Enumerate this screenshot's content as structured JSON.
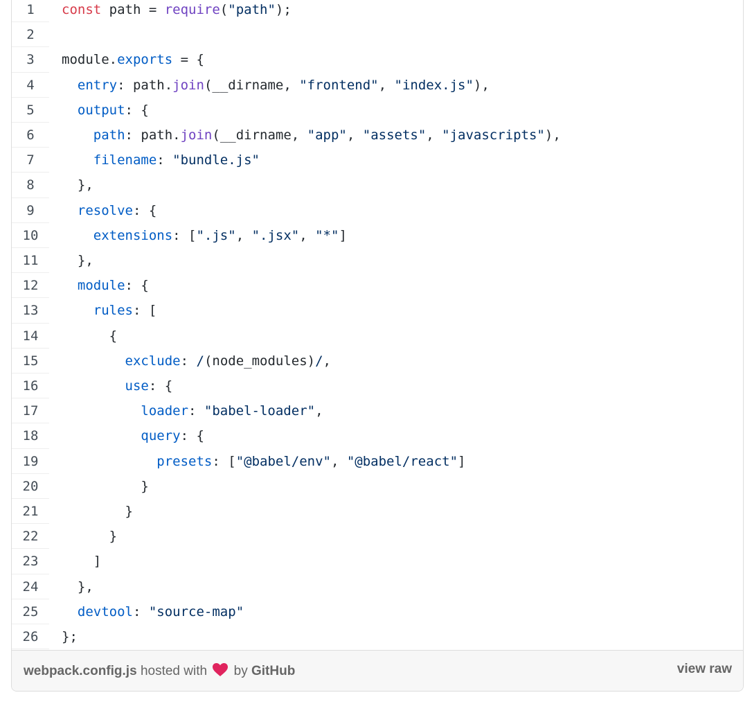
{
  "gist": {
    "lines": [
      {
        "no": "1",
        "tokens": [
          {
            "t": "kw",
            "v": "const"
          },
          {
            "t": "plain",
            "v": " path = "
          },
          {
            "t": "fn",
            "v": "require"
          },
          {
            "t": "plain",
            "v": "("
          },
          {
            "t": "str",
            "v": "\"path\""
          },
          {
            "t": "plain",
            "v": ");"
          }
        ]
      },
      {
        "no": "2",
        "tokens": []
      },
      {
        "no": "3",
        "tokens": [
          {
            "t": "plain",
            "v": "module."
          },
          {
            "t": "prop",
            "v": "exports"
          },
          {
            "t": "plain",
            "v": " = {"
          }
        ]
      },
      {
        "no": "4",
        "tokens": [
          {
            "t": "plain",
            "v": "  "
          },
          {
            "t": "prop",
            "v": "entry"
          },
          {
            "t": "plain",
            "v": ": path."
          },
          {
            "t": "fn",
            "v": "join"
          },
          {
            "t": "plain",
            "v": "(__dirname, "
          },
          {
            "t": "str",
            "v": "\"frontend\""
          },
          {
            "t": "plain",
            "v": ", "
          },
          {
            "t": "str",
            "v": "\"index.js\""
          },
          {
            "t": "plain",
            "v": "),"
          }
        ]
      },
      {
        "no": "5",
        "tokens": [
          {
            "t": "plain",
            "v": "  "
          },
          {
            "t": "prop",
            "v": "output"
          },
          {
            "t": "plain",
            "v": ": {"
          }
        ]
      },
      {
        "no": "6",
        "tokens": [
          {
            "t": "plain",
            "v": "    "
          },
          {
            "t": "prop",
            "v": "path"
          },
          {
            "t": "plain",
            "v": ": path."
          },
          {
            "t": "fn",
            "v": "join"
          },
          {
            "t": "plain",
            "v": "(__dirname, "
          },
          {
            "t": "str",
            "v": "\"app\""
          },
          {
            "t": "plain",
            "v": ", "
          },
          {
            "t": "str",
            "v": "\"assets\""
          },
          {
            "t": "plain",
            "v": ", "
          },
          {
            "t": "str",
            "v": "\"javascripts\""
          },
          {
            "t": "plain",
            "v": "),"
          }
        ]
      },
      {
        "no": "7",
        "tokens": [
          {
            "t": "plain",
            "v": "    "
          },
          {
            "t": "prop",
            "v": "filename"
          },
          {
            "t": "plain",
            "v": ": "
          },
          {
            "t": "str",
            "v": "\"bundle.js\""
          }
        ]
      },
      {
        "no": "8",
        "tokens": [
          {
            "t": "plain",
            "v": "  },"
          }
        ]
      },
      {
        "no": "9",
        "tokens": [
          {
            "t": "plain",
            "v": "  "
          },
          {
            "t": "prop",
            "v": "resolve"
          },
          {
            "t": "plain",
            "v": ": {"
          }
        ]
      },
      {
        "no": "10",
        "tokens": [
          {
            "t": "plain",
            "v": "    "
          },
          {
            "t": "prop",
            "v": "extensions"
          },
          {
            "t": "plain",
            "v": ": ["
          },
          {
            "t": "str",
            "v": "\".js\""
          },
          {
            "t": "plain",
            "v": ", "
          },
          {
            "t": "str",
            "v": "\".jsx\""
          },
          {
            "t": "plain",
            "v": ", "
          },
          {
            "t": "str",
            "v": "\"*\""
          },
          {
            "t": "plain",
            "v": "]"
          }
        ]
      },
      {
        "no": "11",
        "tokens": [
          {
            "t": "plain",
            "v": "  },"
          }
        ]
      },
      {
        "no": "12",
        "tokens": [
          {
            "t": "plain",
            "v": "  "
          },
          {
            "t": "prop",
            "v": "module"
          },
          {
            "t": "plain",
            "v": ": {"
          }
        ]
      },
      {
        "no": "13",
        "tokens": [
          {
            "t": "plain",
            "v": "    "
          },
          {
            "t": "prop",
            "v": "rules"
          },
          {
            "t": "plain",
            "v": ": ["
          }
        ]
      },
      {
        "no": "14",
        "tokens": [
          {
            "t": "plain",
            "v": "      {"
          }
        ]
      },
      {
        "no": "15",
        "tokens": [
          {
            "t": "plain",
            "v": "        "
          },
          {
            "t": "prop",
            "v": "exclude"
          },
          {
            "t": "plain",
            "v": ": "
          },
          {
            "t": "re",
            "v": "/"
          },
          {
            "t": "plain",
            "v": "(node_modules)"
          },
          {
            "t": "re",
            "v": "/"
          },
          {
            "t": "plain",
            "v": ","
          }
        ]
      },
      {
        "no": "16",
        "tokens": [
          {
            "t": "plain",
            "v": "        "
          },
          {
            "t": "prop",
            "v": "use"
          },
          {
            "t": "plain",
            "v": ": {"
          }
        ]
      },
      {
        "no": "17",
        "tokens": [
          {
            "t": "plain",
            "v": "          "
          },
          {
            "t": "prop",
            "v": "loader"
          },
          {
            "t": "plain",
            "v": ": "
          },
          {
            "t": "str",
            "v": "\"babel-loader\""
          },
          {
            "t": "plain",
            "v": ","
          }
        ]
      },
      {
        "no": "18",
        "tokens": [
          {
            "t": "plain",
            "v": "          "
          },
          {
            "t": "prop",
            "v": "query"
          },
          {
            "t": "plain",
            "v": ": {"
          }
        ]
      },
      {
        "no": "19",
        "tokens": [
          {
            "t": "plain",
            "v": "            "
          },
          {
            "t": "prop",
            "v": "presets"
          },
          {
            "t": "plain",
            "v": ": ["
          },
          {
            "t": "str",
            "v": "\"@babel/env\""
          },
          {
            "t": "plain",
            "v": ", "
          },
          {
            "t": "str",
            "v": "\"@babel/react\""
          },
          {
            "t": "plain",
            "v": "]"
          }
        ]
      },
      {
        "no": "20",
        "tokens": [
          {
            "t": "plain",
            "v": "          }"
          }
        ]
      },
      {
        "no": "21",
        "tokens": [
          {
            "t": "plain",
            "v": "        }"
          }
        ]
      },
      {
        "no": "22",
        "tokens": [
          {
            "t": "plain",
            "v": "      }"
          }
        ]
      },
      {
        "no": "23",
        "tokens": [
          {
            "t": "plain",
            "v": "    ]"
          }
        ]
      },
      {
        "no": "24",
        "tokens": [
          {
            "t": "plain",
            "v": "  },"
          }
        ]
      },
      {
        "no": "25",
        "tokens": [
          {
            "t": "plain",
            "v": "  "
          },
          {
            "t": "prop",
            "v": "devtool"
          },
          {
            "t": "plain",
            "v": ": "
          },
          {
            "t": "str",
            "v": "\"source-map\""
          }
        ]
      },
      {
        "no": "26",
        "tokens": [
          {
            "t": "plain",
            "v": "};"
          }
        ]
      }
    ]
  },
  "footer": {
    "filename": "webpack.config.js",
    "hosted_with": "hosted with",
    "heart_icon": "heart-icon",
    "by": "by",
    "host": "GitHub",
    "view_raw": "view raw"
  },
  "colors": {
    "keyword": "#d73a49",
    "function": "#6f42c1",
    "string": "#032f62",
    "property": "#005cc5",
    "plain": "#24292e",
    "heart": "#e0245e"
  }
}
